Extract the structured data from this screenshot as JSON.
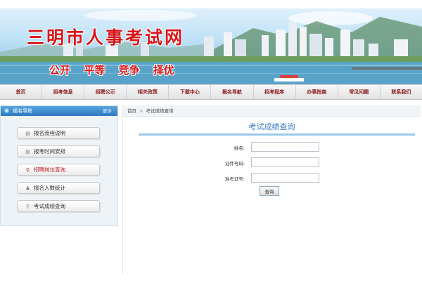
{
  "header": {
    "site_title": "三明市人事考试网",
    "slogan": [
      "公开",
      "平等",
      "竞争",
      "择优"
    ]
  },
  "nav": {
    "items": [
      "首页",
      "招考信息",
      "招聘公示",
      "相关政策",
      "下载中心",
      "报名导航",
      "招考程序",
      "办事指南",
      "常见问题",
      "联系我们"
    ]
  },
  "sidebar": {
    "title": "报名导航",
    "more": "更多",
    "items": [
      {
        "label": "报名流程说明",
        "icon": "document-icon"
      },
      {
        "label": "报考时间安排",
        "icon": "document-icon"
      },
      {
        "label": "招聘岗位查询",
        "icon": "magnifier-icon"
      },
      {
        "label": "报名人数统计",
        "icon": "people-icon"
      },
      {
        "label": "考试成绩查询",
        "icon": "magnifier-icon"
      }
    ]
  },
  "breadcrumb": {
    "home": "首页",
    "separator": ">",
    "current": "考试成绩查询"
  },
  "main": {
    "title": "考试成绩查询",
    "fields": [
      {
        "label": "姓名:",
        "value": ""
      },
      {
        "label": "证件号码:",
        "value": ""
      },
      {
        "label": "准考证号:",
        "value": ""
      }
    ],
    "submit_label": "查询"
  },
  "colors": {
    "brand_red": "#d8161b",
    "nav_text": "#8b1a1a",
    "accent_blue": "#3a7cc4"
  }
}
